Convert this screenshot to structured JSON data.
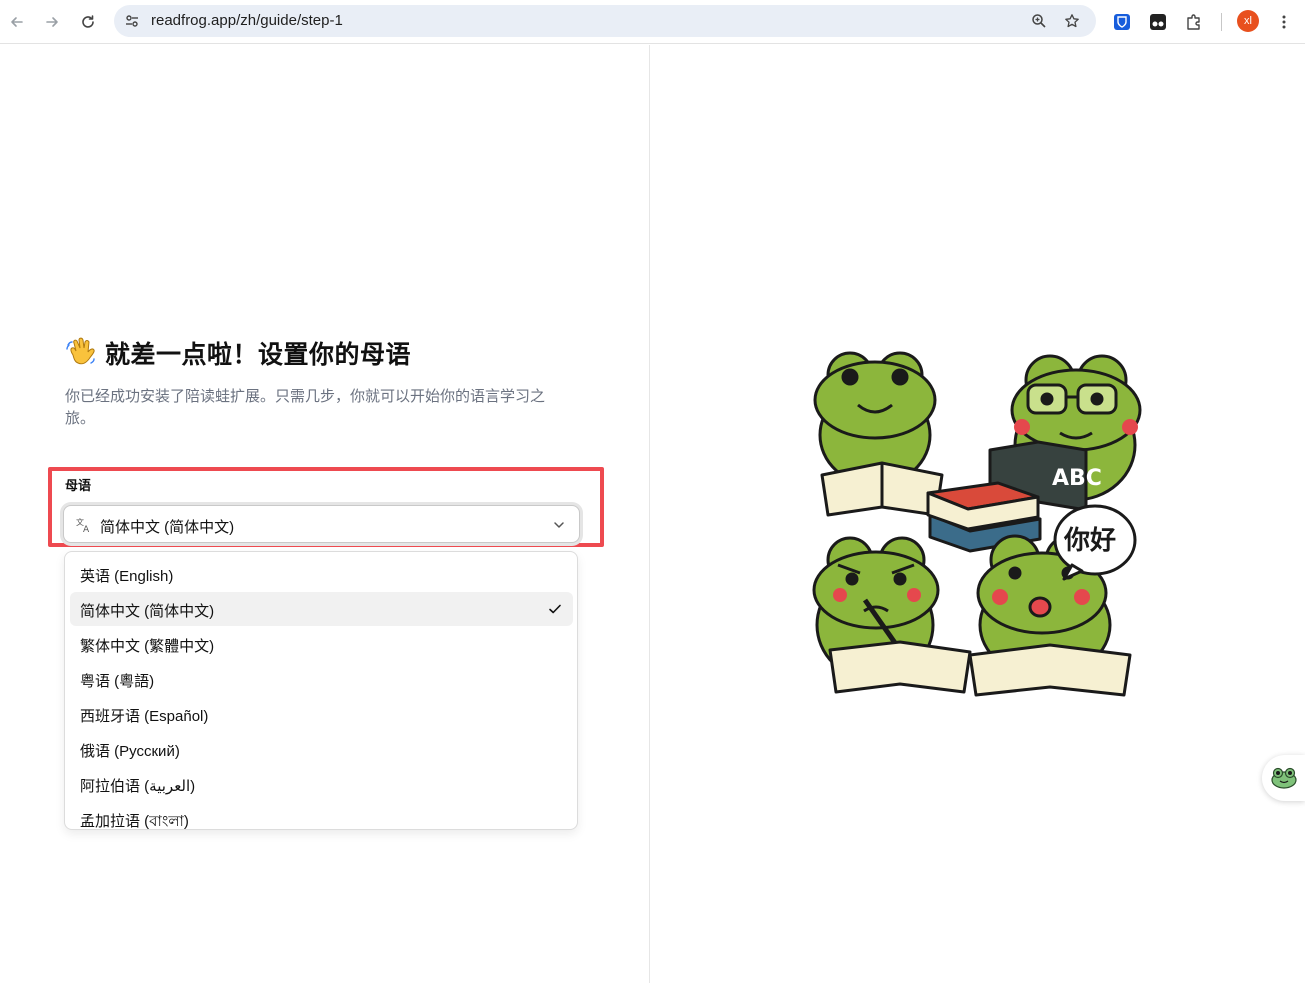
{
  "browser": {
    "url": "readfrog.app/zh/guide/step-1",
    "avatar_initials": "xl"
  },
  "page": {
    "heading": "就差一点啦！设置你的母语",
    "subtitle": "你已经成功安装了陪读蛙扩展。只需几步，你就可以开始你的语言学习之旅。",
    "field_label": "母语",
    "selected_language": "简体中文 (简体中文)",
    "options": [
      {
        "label": "英语 (English)",
        "selected": false
      },
      {
        "label": "简体中文 (简体中文)",
        "selected": true
      },
      {
        "label": "繁体中文 (繁體中文)",
        "selected": false
      },
      {
        "label": "粤语 (粵語)",
        "selected": false
      },
      {
        "label": "西班牙语 (Español)",
        "selected": false
      },
      {
        "label": "俄语 (Русский)",
        "selected": false
      },
      {
        "label": "阿拉伯语 (العربية)",
        "selected": false
      },
      {
        "label": "孟加拉语 (বাংলা)",
        "selected": false
      }
    ]
  },
  "illustration": {
    "book_text": "ABC",
    "speech_bubble_text": "你好"
  },
  "colors": {
    "highlight_border": "#ee4a50",
    "frog_green": "#8cb63c",
    "avatar_bg": "#e8501e"
  }
}
